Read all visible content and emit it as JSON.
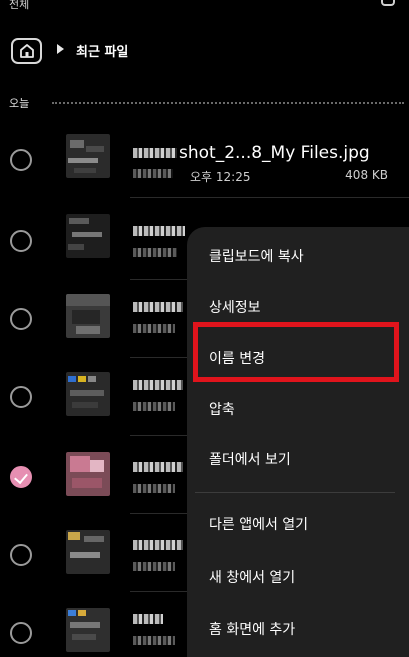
{
  "topbar": {
    "all_label": "전체",
    "title_fragment": "∙ ̄ ̄ ̄ ̄ ̄"
  },
  "breadcrumb": {
    "current": "최근 파일"
  },
  "section": {
    "label": "오늘"
  },
  "files": [
    {
      "name": "shot_2...8_My Files.jpg",
      "time": "오후 12:25",
      "size": "408 KB",
      "checked": false
    },
    {
      "name": "",
      "checked": false
    },
    {
      "name": "",
      "checked": false
    },
    {
      "name": "",
      "checked": false
    },
    {
      "name": "",
      "checked": true
    },
    {
      "name": "",
      "checked": false
    },
    {
      "name": "",
      "checked": false
    }
  ],
  "context_menu": {
    "items": [
      {
        "label": "클립보드에 복사"
      },
      {
        "label": "상세정보"
      },
      {
        "label": "이름 변경",
        "highlighted": true
      },
      {
        "label": "압축"
      },
      {
        "label": "폴더에서 보기"
      },
      {
        "label": "다른 앱에서 열기"
      },
      {
        "label": "새 창에서 열기"
      },
      {
        "label": "홈 화면에 추가"
      }
    ]
  },
  "colors": {
    "background": "#000000",
    "menu_background": "#202020",
    "checked_accent": "#e68fb2",
    "highlight_border": "#e0141c"
  }
}
